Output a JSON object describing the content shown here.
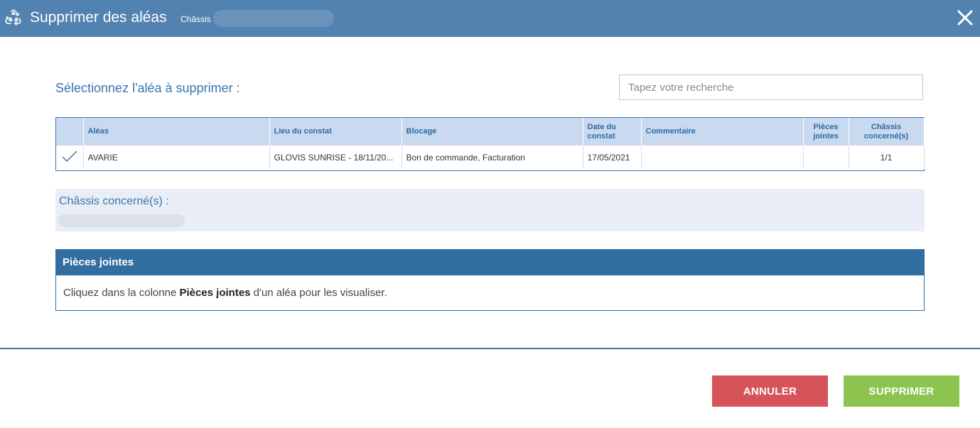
{
  "dialog": {
    "title": "Supprimer des aléas",
    "subtitle": "Châssis",
    "icon": "recycle-icon",
    "close_icon": "close-icon"
  },
  "selection": {
    "prompt": "Sélectionnez l'aléa à supprimer :",
    "search_placeholder": "Tapez votre recherche"
  },
  "table": {
    "headers": [
      "",
      "Aléas",
      "Lieu du constat",
      "Blocage",
      "Date du constat",
      "Commentaire",
      "Pièces jointes",
      "Châssis concerné(s)"
    ],
    "rows": [
      {
        "check_icon": "checkmark-icon",
        "alea": "AVARIE",
        "lieu": "GLOVIS SUNRISE - 18/11/20...",
        "blocage": "Bon de commande, Facturation",
        "date": "17/05/2021",
        "commentaire": "",
        "pieces": "",
        "chassis": "1/1"
      }
    ]
  },
  "chassis_panel": {
    "label": "Châssis concerné(s) :"
  },
  "attachments": {
    "title": "Pièces jointes",
    "text_before": "Cliquez dans la colonne ",
    "text_bold": "Pièces jointes",
    "text_after": " d'un aléa pour les visualiser."
  },
  "footer": {
    "cancel_label": "ANNULER",
    "delete_label": "SUPPRIMER"
  },
  "colors": {
    "header_bar": "#5282b0",
    "accent_text": "#3a76ad",
    "cancel": "#d65459",
    "confirm": "#8cc44f"
  }
}
